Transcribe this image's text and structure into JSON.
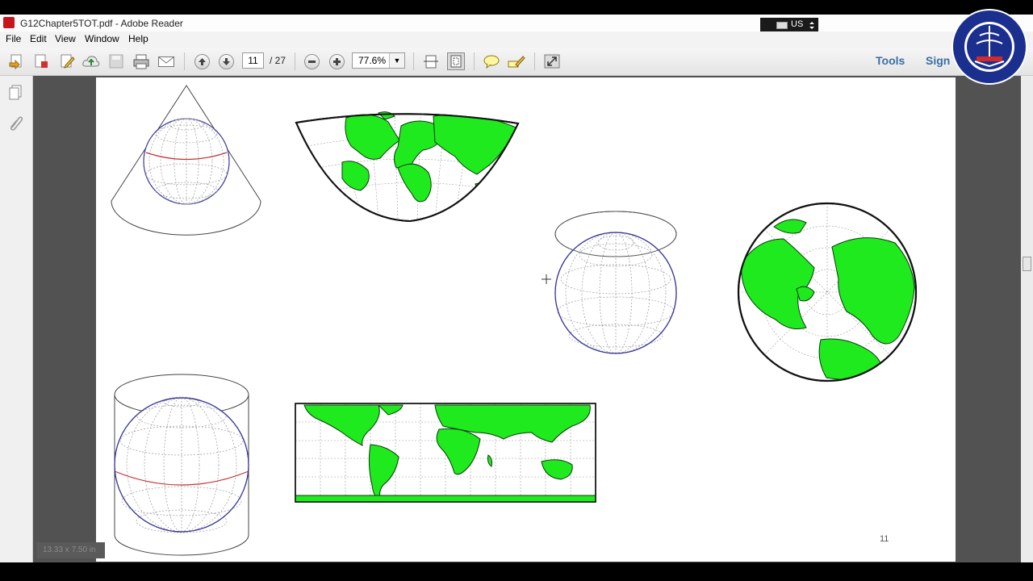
{
  "window": {
    "title": "G12Chapter5TOT.pdf - Adobe Reader",
    "language_indicator": "US"
  },
  "menu": [
    "File",
    "Edit",
    "View",
    "Window",
    "Help"
  ],
  "toolbar": {
    "current_page": "11",
    "total_pages": "/ 27",
    "zoom": "77.6%",
    "tools_label": "Tools",
    "sign_label": "Sign"
  },
  "document": {
    "page_number": "11",
    "page_size": "13.33 x 7.50 in",
    "land_color": "#1eea1e"
  }
}
